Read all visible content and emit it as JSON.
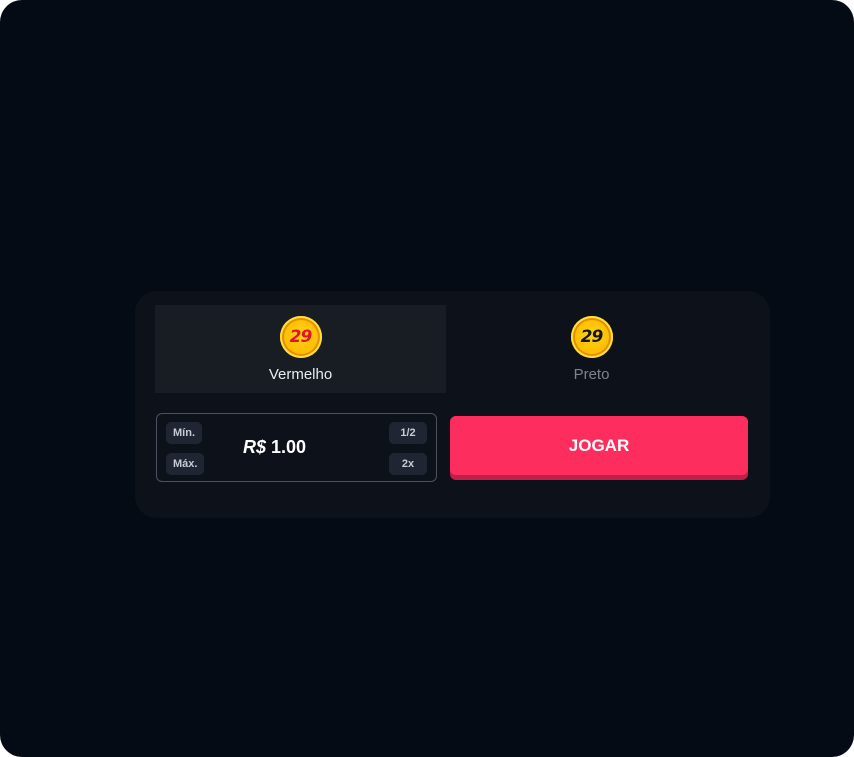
{
  "choices": [
    {
      "coin_text": "29",
      "label": "Vermelho",
      "selected": true
    },
    {
      "coin_text": "29",
      "label": "Preto",
      "selected": false
    }
  ],
  "bet": {
    "min_label": "Mín.",
    "max_label": "Máx.",
    "half_label": "1/2",
    "double_label": "2x",
    "currency": "R$",
    "amount": "1.00"
  },
  "play_button": {
    "label": "JOGAR"
  },
  "colors": {
    "background": "#050b15",
    "panel": "#0d1119",
    "accent": "#fd2d5e",
    "coin": "#ffbd00"
  }
}
